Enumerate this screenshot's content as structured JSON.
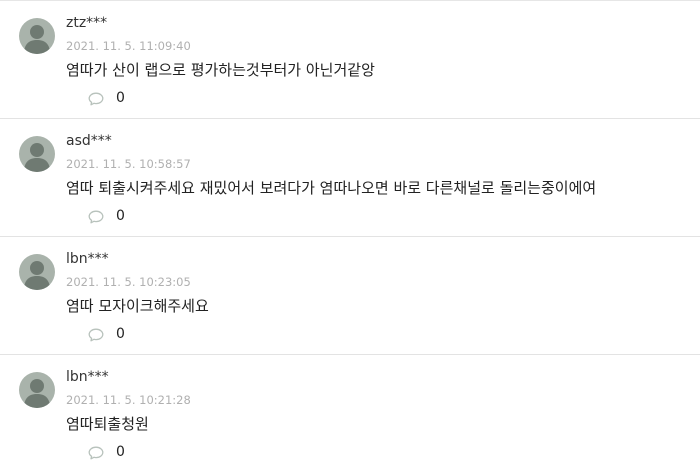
{
  "comments": [
    {
      "username": "ztz***",
      "timestamp": "2021. 11. 5. 11:09:40",
      "text": "염따가 산이 랩으로 평가하는것부터가 아닌거같앙",
      "reply_count": "0"
    },
    {
      "username": "asd***",
      "timestamp": "2021. 11. 5. 10:58:57",
      "text": "염따 퇴출시켜주세요 재밌어서 보려다가 염따나오면 바로 다른채널로 돌리는중이에여",
      "reply_count": "0"
    },
    {
      "username": "lbn***",
      "timestamp": "2021. 11. 5. 10:23:05",
      "text": "염따 모자이크해주세요",
      "reply_count": "0"
    },
    {
      "username": "lbn***",
      "timestamp": "2021. 11. 5. 10:21:28",
      "text": "염따퇴출청원",
      "reply_count": "0"
    }
  ],
  "icons": {
    "avatar": "default-avatar-icon",
    "reply": "comment-bubble-icon"
  },
  "colors": {
    "avatar_bg": "#a9b3ab",
    "avatar_figure": "#6f7a72",
    "timestamp": "#b0b0b0",
    "divider": "#e3e3e3",
    "reply_icon": "#b8c2bc"
  }
}
